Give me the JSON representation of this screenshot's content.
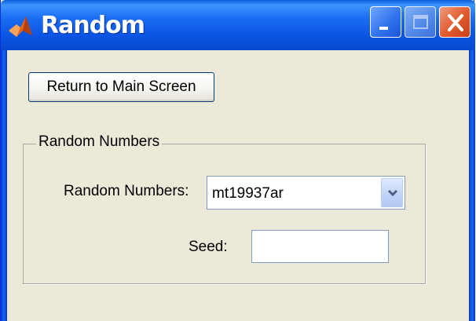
{
  "window": {
    "title": "Random",
    "app_icon": "matlab-logo-icon",
    "controls": {
      "minimize": "minimize-icon",
      "maximize": "maximize-icon",
      "close": "close-icon"
    }
  },
  "buttons": {
    "return_label": "Return to Main Screen"
  },
  "panel": {
    "title": "Random Numbers",
    "random_numbers_label": "Random Numbers:",
    "random_numbers_selected": "mt19937ar",
    "seed_label": "Seed:",
    "seed_value": ""
  },
  "colors": {
    "titlebar": "#0a5fd8",
    "window_bg": "#ece9d8",
    "close_button": "#e05a2c"
  }
}
